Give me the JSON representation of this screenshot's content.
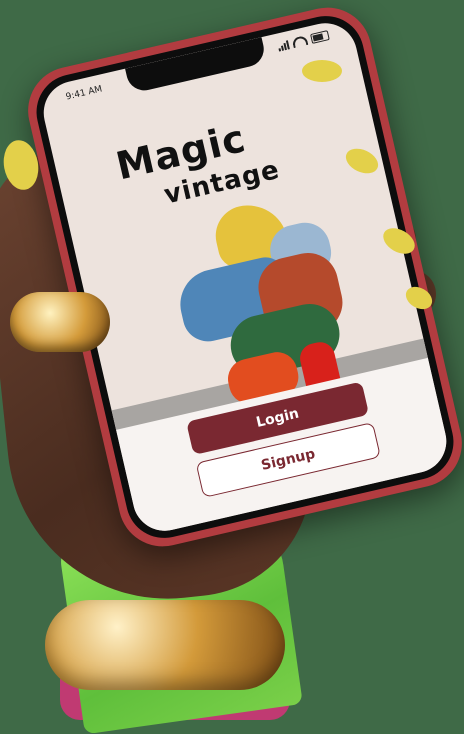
{
  "app": {
    "title_line1": "Magic",
    "title_line2": "vintage"
  },
  "status_bar": {
    "time": "9:41 AM"
  },
  "buttons": {
    "login": "Login",
    "signup": "Signup"
  },
  "colors": {
    "background": "#3f6a47",
    "phone_case": "#b23c40",
    "primary_button": "#7a2831",
    "screen_bg": "#ede3dd"
  },
  "icons": [
    "signal-icon",
    "wifi-icon",
    "battery-icon"
  ]
}
